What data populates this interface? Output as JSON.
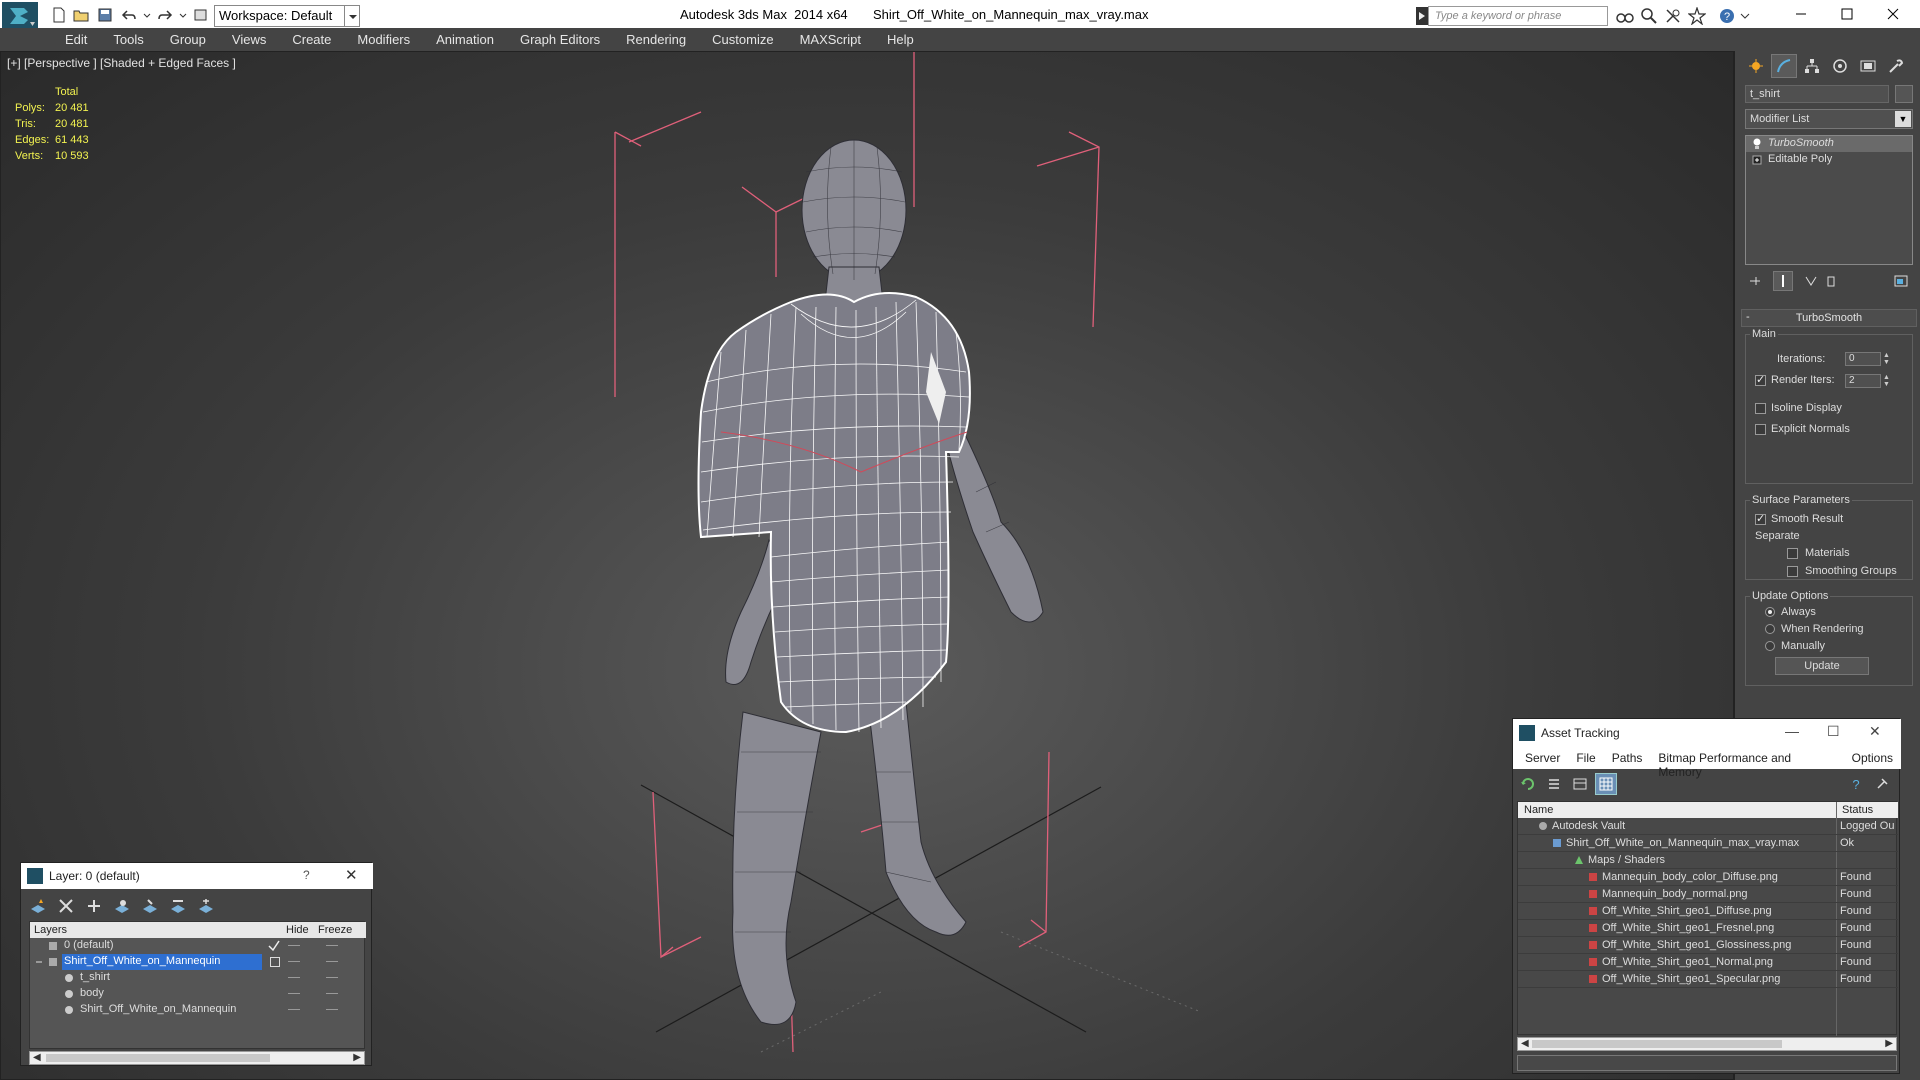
{
  "titlebar": {
    "workspace": "Workspace: Default",
    "title": "Autodesk 3ds Max  2014 x64       Shirt_Off_White_on_Mannequin_max_vray.max",
    "search_placeholder": "Type a keyword or phrase"
  },
  "menu": [
    "Edit",
    "Tools",
    "Group",
    "Views",
    "Create",
    "Modifiers",
    "Animation",
    "Graph Editors",
    "Rendering",
    "Customize",
    "MAXScript",
    "Help"
  ],
  "viewport": {
    "label": "[+] [Perspective ] [Shaded + Edged Faces ]",
    "stats": {
      "header": "Total",
      "rows": [
        {
          "k": "Polys:",
          "v": "20 481"
        },
        {
          "k": "Tris:",
          "v": "20 481"
        },
        {
          "k": "Edges:",
          "v": "61 443"
        },
        {
          "k": "Verts:",
          "v": "10 593"
        }
      ]
    }
  },
  "command_panel": {
    "object_name": "t_shirt",
    "modifier_list": "Modifier List",
    "stack": [
      "TurboSmooth",
      "Editable Poly"
    ],
    "rollout_title": "TurboSmooth",
    "main_label": "Main",
    "iterations_label": "Iterations:",
    "iterations_value": "0",
    "render_iters_label": "Render Iters:",
    "render_iters_value": "2",
    "isoline_display": "Isoline Display",
    "explicit_normals": "Explicit Normals",
    "surface_params": "Surface Parameters",
    "smooth_result": "Smooth Result",
    "separate": "Separate",
    "materials": "Materials",
    "smoothing_groups": "Smoothing Groups",
    "update_options": "Update Options",
    "always": "Always",
    "when_rendering": "When Rendering",
    "manually": "Manually",
    "update_button": "Update"
  },
  "layer_window": {
    "title": "Layer: 0 (default)",
    "help": "?",
    "columns": [
      "Layers",
      "Hide",
      "Freeze"
    ],
    "rows": [
      {
        "name": "0 (default)"
      },
      {
        "name": "Shirt_Off_White_on_Mannequin"
      },
      {
        "name": "t_shirt"
      },
      {
        "name": "body"
      },
      {
        "name": "Shirt_Off_White_on_Mannequin"
      }
    ]
  },
  "asset_window": {
    "title": "Asset Tracking",
    "menu": [
      "Server",
      "File",
      "Paths",
      "Bitmap Performance and Memory",
      "Options"
    ],
    "columns": [
      "Name",
      "Status"
    ],
    "rows": [
      {
        "name": "Autodesk Vault",
        "status": "Logged Ou"
      },
      {
        "name": "Shirt_Off_White_on_Mannequin_max_vray.max",
        "status": "Ok"
      },
      {
        "name": "Maps / Shaders",
        "status": ""
      },
      {
        "name": "Mannequin_body_color_Diffuse.png",
        "status": "Found"
      },
      {
        "name": "Mannequin_body_normal.png",
        "status": "Found"
      },
      {
        "name": "Off_White_Shirt_geo1_Diffuse.png",
        "status": "Found"
      },
      {
        "name": "Off_White_Shirt_geo1_Fresnel.png",
        "status": "Found"
      },
      {
        "name": "Off_White_Shirt_geo1_Glossiness.png",
        "status": "Found"
      },
      {
        "name": "Off_White_Shirt_geo1_Normal.png",
        "status": "Found"
      },
      {
        "name": "Off_White_Shirt_geo1_Specular.png",
        "status": "Found"
      }
    ]
  },
  "colors": {
    "stats_yellow": "#f2f250",
    "bbox_pink": "#e0607a",
    "selection_blue": "#2e6fd1",
    "grid": "#1a1a1a"
  }
}
